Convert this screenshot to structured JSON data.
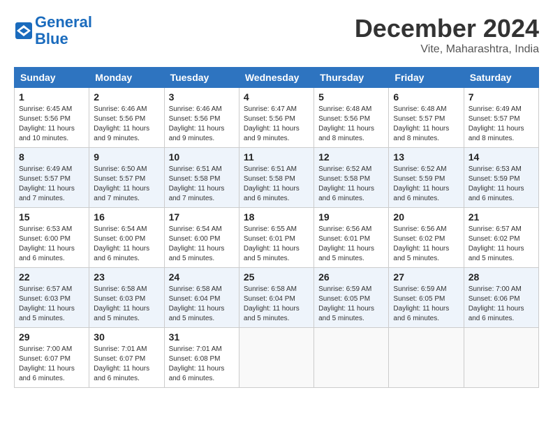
{
  "header": {
    "logo_line1": "General",
    "logo_line2": "Blue",
    "month": "December 2024",
    "location": "Vite, Maharashtra, India"
  },
  "weekdays": [
    "Sunday",
    "Monday",
    "Tuesday",
    "Wednesday",
    "Thursday",
    "Friday",
    "Saturday"
  ],
  "weeks": [
    [
      {
        "day": "1",
        "info": "Sunrise: 6:45 AM\nSunset: 5:56 PM\nDaylight: 11 hours and 10 minutes."
      },
      {
        "day": "2",
        "info": "Sunrise: 6:46 AM\nSunset: 5:56 PM\nDaylight: 11 hours and 9 minutes."
      },
      {
        "day": "3",
        "info": "Sunrise: 6:46 AM\nSunset: 5:56 PM\nDaylight: 11 hours and 9 minutes."
      },
      {
        "day": "4",
        "info": "Sunrise: 6:47 AM\nSunset: 5:56 PM\nDaylight: 11 hours and 9 minutes."
      },
      {
        "day": "5",
        "info": "Sunrise: 6:48 AM\nSunset: 5:56 PM\nDaylight: 11 hours and 8 minutes."
      },
      {
        "day": "6",
        "info": "Sunrise: 6:48 AM\nSunset: 5:57 PM\nDaylight: 11 hours and 8 minutes."
      },
      {
        "day": "7",
        "info": "Sunrise: 6:49 AM\nSunset: 5:57 PM\nDaylight: 11 hours and 8 minutes."
      }
    ],
    [
      {
        "day": "8",
        "info": "Sunrise: 6:49 AM\nSunset: 5:57 PM\nDaylight: 11 hours and 7 minutes."
      },
      {
        "day": "9",
        "info": "Sunrise: 6:50 AM\nSunset: 5:57 PM\nDaylight: 11 hours and 7 minutes."
      },
      {
        "day": "10",
        "info": "Sunrise: 6:51 AM\nSunset: 5:58 PM\nDaylight: 11 hours and 7 minutes."
      },
      {
        "day": "11",
        "info": "Sunrise: 6:51 AM\nSunset: 5:58 PM\nDaylight: 11 hours and 6 minutes."
      },
      {
        "day": "12",
        "info": "Sunrise: 6:52 AM\nSunset: 5:58 PM\nDaylight: 11 hours and 6 minutes."
      },
      {
        "day": "13",
        "info": "Sunrise: 6:52 AM\nSunset: 5:59 PM\nDaylight: 11 hours and 6 minutes."
      },
      {
        "day": "14",
        "info": "Sunrise: 6:53 AM\nSunset: 5:59 PM\nDaylight: 11 hours and 6 minutes."
      }
    ],
    [
      {
        "day": "15",
        "info": "Sunrise: 6:53 AM\nSunset: 6:00 PM\nDaylight: 11 hours and 6 minutes."
      },
      {
        "day": "16",
        "info": "Sunrise: 6:54 AM\nSunset: 6:00 PM\nDaylight: 11 hours and 6 minutes."
      },
      {
        "day": "17",
        "info": "Sunrise: 6:54 AM\nSunset: 6:00 PM\nDaylight: 11 hours and 5 minutes."
      },
      {
        "day": "18",
        "info": "Sunrise: 6:55 AM\nSunset: 6:01 PM\nDaylight: 11 hours and 5 minutes."
      },
      {
        "day": "19",
        "info": "Sunrise: 6:56 AM\nSunset: 6:01 PM\nDaylight: 11 hours and 5 minutes."
      },
      {
        "day": "20",
        "info": "Sunrise: 6:56 AM\nSunset: 6:02 PM\nDaylight: 11 hours and 5 minutes."
      },
      {
        "day": "21",
        "info": "Sunrise: 6:57 AM\nSunset: 6:02 PM\nDaylight: 11 hours and 5 minutes."
      }
    ],
    [
      {
        "day": "22",
        "info": "Sunrise: 6:57 AM\nSunset: 6:03 PM\nDaylight: 11 hours and 5 minutes."
      },
      {
        "day": "23",
        "info": "Sunrise: 6:58 AM\nSunset: 6:03 PM\nDaylight: 11 hours and 5 minutes."
      },
      {
        "day": "24",
        "info": "Sunrise: 6:58 AM\nSunset: 6:04 PM\nDaylight: 11 hours and 5 minutes."
      },
      {
        "day": "25",
        "info": "Sunrise: 6:58 AM\nSunset: 6:04 PM\nDaylight: 11 hours and 5 minutes."
      },
      {
        "day": "26",
        "info": "Sunrise: 6:59 AM\nSunset: 6:05 PM\nDaylight: 11 hours and 5 minutes."
      },
      {
        "day": "27",
        "info": "Sunrise: 6:59 AM\nSunset: 6:05 PM\nDaylight: 11 hours and 6 minutes."
      },
      {
        "day": "28",
        "info": "Sunrise: 7:00 AM\nSunset: 6:06 PM\nDaylight: 11 hours and 6 minutes."
      }
    ],
    [
      {
        "day": "29",
        "info": "Sunrise: 7:00 AM\nSunset: 6:07 PM\nDaylight: 11 hours and 6 minutes."
      },
      {
        "day": "30",
        "info": "Sunrise: 7:01 AM\nSunset: 6:07 PM\nDaylight: 11 hours and 6 minutes."
      },
      {
        "day": "31",
        "info": "Sunrise: 7:01 AM\nSunset: 6:08 PM\nDaylight: 11 hours and 6 minutes."
      },
      null,
      null,
      null,
      null
    ]
  ]
}
